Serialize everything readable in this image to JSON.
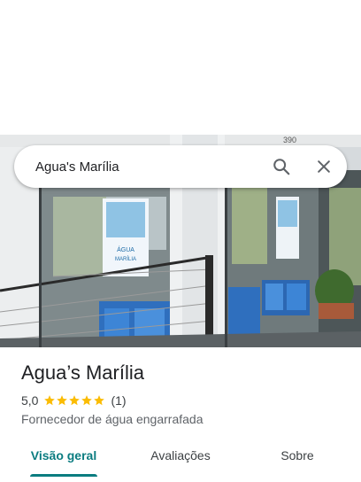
{
  "search": {
    "query": "Agua's Marília"
  },
  "place": {
    "name": "Agua’s Marília",
    "rating": "5,0",
    "stars": 5,
    "review_count": "(1)",
    "category": "Fornecedor de água engarrafada"
  },
  "photo": {
    "sign_text_1": "ÁGUA",
    "sign_text_2": "MARÍLIA",
    "building_number": "390"
  },
  "tabs": [
    {
      "label": "Visão geral",
      "active": true
    },
    {
      "label": "Avaliações",
      "active": false
    },
    {
      "label": "Sobre",
      "active": false
    }
  ],
  "colors": {
    "accent": "#0b7c80",
    "star": "#fbbc04",
    "text": "#202124",
    "muted": "#5f6368"
  },
  "icons": {
    "search": "search-icon",
    "close": "close-icon",
    "star": "star-icon"
  }
}
